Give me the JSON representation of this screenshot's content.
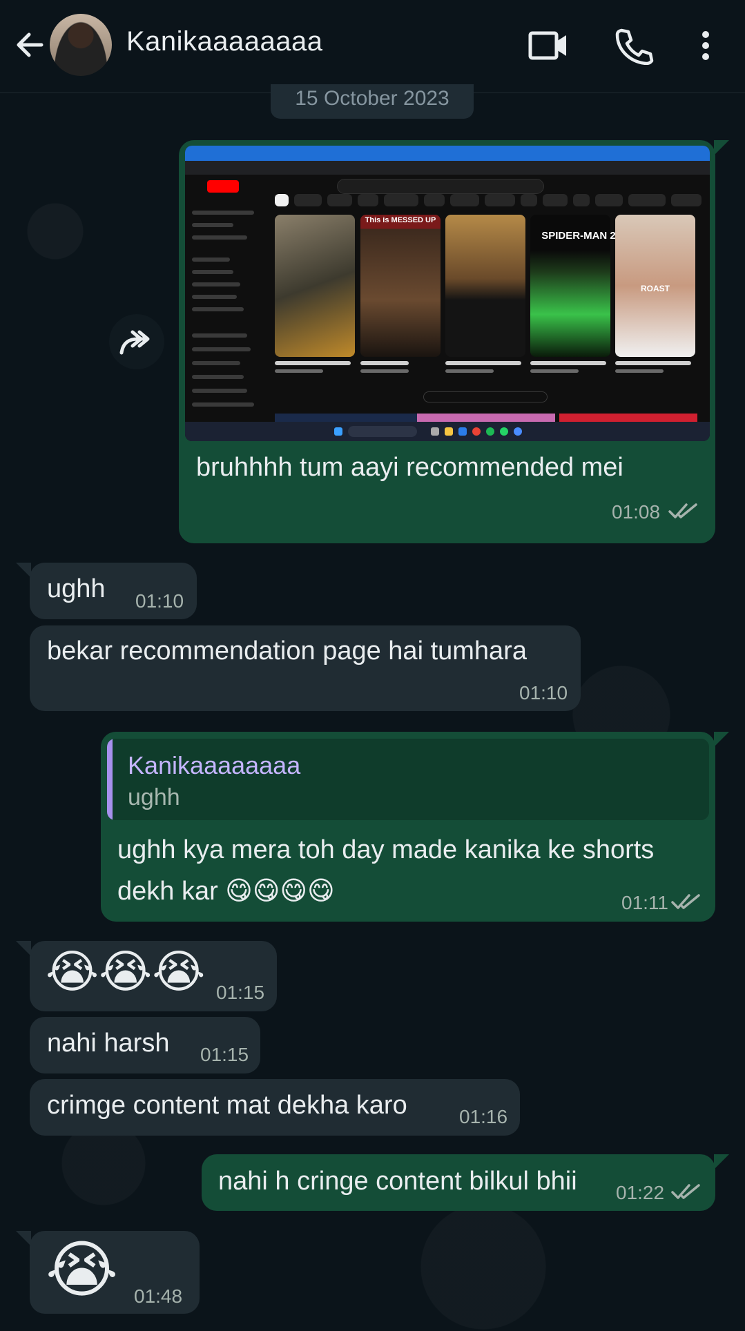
{
  "header": {
    "contact_name": "Kanikaaaaaaaa",
    "icons": [
      "back-arrow-icon",
      "avatar",
      "video-call-icon",
      "voice-call-icon",
      "more-menu-icon"
    ]
  },
  "date_chip": "15 October 2023",
  "messages": [
    {
      "direction": "outgoing",
      "type": "image",
      "image_description": "YouTube homepage screenshot with Shorts",
      "shorts_thumbnail_labels": [
        "This is MESSED UP",
        "SPIDER-MAN 2",
        "ROAST"
      ],
      "text": "bruhhhh tum aayi recommended mei",
      "time": "01:08",
      "status": "read"
    },
    {
      "direction": "incoming",
      "text": "ughh",
      "time": "01:10"
    },
    {
      "direction": "incoming",
      "text": "bekar recommendation page hai tumhara",
      "time": "01:10"
    },
    {
      "direction": "outgoing",
      "quoted": {
        "name": "Kanikaaaaaaaa",
        "text": "ughh"
      },
      "text_line1": "ughh kya mera toh day made kanika ke shorts",
      "text_line2": "dekh kar 😋😋😋😋",
      "time": "01:11",
      "status": "read"
    },
    {
      "direction": "incoming",
      "text": "😭😭😭",
      "time": "01:15"
    },
    {
      "direction": "incoming",
      "text": "nahi harsh",
      "time": "01:15"
    },
    {
      "direction": "incoming",
      "text": "crimge content mat dekha karo",
      "time": "01:16"
    },
    {
      "direction": "outgoing",
      "text": "nahi h cringe content bilkul bhii",
      "time": "01:22",
      "status": "read"
    },
    {
      "direction": "incoming",
      "text": "😭",
      "time": "01:48"
    }
  ],
  "colors": {
    "background": "#0b141a",
    "outgoing_bubble": "#144d37",
    "incoming_bubble": "#202c33",
    "read_ticks": "#a6b3ad",
    "quote_accent": "#a791ed"
  }
}
